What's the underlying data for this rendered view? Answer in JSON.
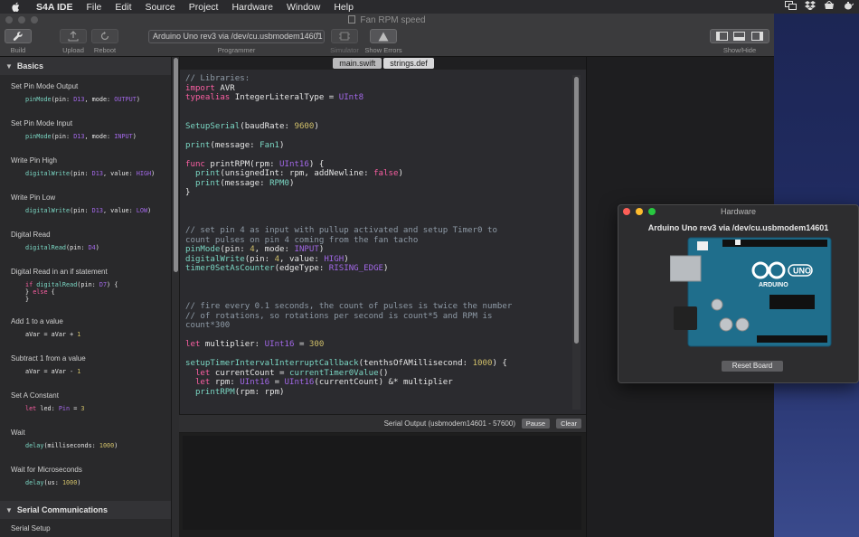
{
  "menubar": {
    "app_name": "S4A IDE",
    "items": [
      "File",
      "Edit",
      "Source",
      "Project",
      "Hardware",
      "Window",
      "Help"
    ]
  },
  "window": {
    "title": "Fan RPM speed"
  },
  "toolbar": {
    "build": "Build",
    "upload": "Upload",
    "reboot": "Reboot",
    "programmer_value": "Arduino Uno rev3 via /dev/cu.usbmodem14601",
    "programmer": "Programmer",
    "simulator": "Simulator",
    "show_errors": "Show Errors",
    "show_hide": "Show/Hide"
  },
  "sidebar": {
    "section_basics": "Basics",
    "items": [
      {
        "title": "Set Pin Mode Output"
      },
      {
        "title": "Set Pin Mode Input"
      },
      {
        "title": "Write Pin High"
      },
      {
        "title": "Write Pin Low"
      },
      {
        "title": "Digital Read"
      },
      {
        "title": "Digital Read in an if statement"
      },
      {
        "title": "Add 1 to a value"
      },
      {
        "title": "Subtract 1 from a value"
      },
      {
        "title": "Set A Constant"
      },
      {
        "title": "Wait"
      },
      {
        "title": "Wait for Microseconds"
      }
    ],
    "section_serial": "Serial Communications",
    "serial_item": "Serial Setup"
  },
  "editor": {
    "tabs": [
      "main.swift",
      "strings.def"
    ],
    "active_tab": "strings.def"
  },
  "serial": {
    "label": "Serial Output (usbmodem14601 - 57600)",
    "pause": "Pause",
    "clear": "Clear"
  },
  "hardware": {
    "title": "Hardware",
    "board": "Arduino Uno rev3 via /dev/cu.usbmodem14601",
    "board_logo": "ARDUINO",
    "board_model": "UNO",
    "reset": "Reset Board"
  },
  "colors": {
    "keyword": "#fc5fa3",
    "number": "#d0bf69",
    "type": "#a167e6",
    "function": "#7ad6c3",
    "comment": "#8e9aa6",
    "board": "#1f6e8c"
  }
}
